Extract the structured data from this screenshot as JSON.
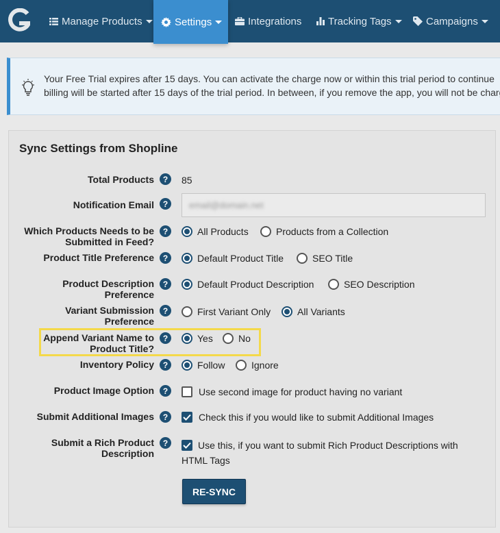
{
  "nav": {
    "items": [
      {
        "label": "Manage Products",
        "icon": "list-icon",
        "caret": true
      },
      {
        "label": "Settings",
        "icon": "gear-icon",
        "caret": true,
        "active": true
      },
      {
        "label": "Integrations",
        "icon": "briefcase-icon",
        "caret": false
      },
      {
        "label": "Tracking Tags",
        "icon": "bar-chart-icon",
        "caret": true
      },
      {
        "label": "Campaigns",
        "icon": "tag-icon",
        "caret": true
      }
    ]
  },
  "alert": {
    "line1": "Your Free Trial expires after 15 days. You can activate the charge now or within this trial period to continue",
    "line2": "billing will be started after 15 days of the trial period. In between, if you remove the app, you will not be charged."
  },
  "panel": {
    "title": "Sync Settings from Shopline",
    "rows": {
      "total_products": {
        "label": "Total Products",
        "value": "85"
      },
      "notification_email": {
        "label": "Notification Email",
        "value": "email@domain.net"
      },
      "which_products": {
        "label_line1": "Which Products Needs to be",
        "label_line2": "Submitted in Feed?",
        "options": [
          "All Products",
          "Products from a Collection"
        ],
        "selected": 0
      },
      "title_pref": {
        "label": "Product Title Preference",
        "options": [
          "Default Product Title",
          "SEO Title"
        ],
        "selected": 0
      },
      "desc_pref": {
        "label_line1": "Product Description",
        "label_line2": "Preference",
        "options": [
          "Default Product Description",
          "SEO Description"
        ],
        "selected": 0
      },
      "variant_pref": {
        "label_line1": "Variant Submission",
        "label_line2": "Preference",
        "options": [
          "First Variant Only",
          "All Variants"
        ],
        "selected": 1
      },
      "append_variant": {
        "label_line1": "Append Variant Name to",
        "label_line2": "Product Title?",
        "options": [
          "Yes",
          "No"
        ],
        "selected": 0
      },
      "inventory_policy": {
        "label": "Inventory Policy",
        "options": [
          "Follow",
          "Ignore"
        ],
        "selected": 0
      },
      "image_option": {
        "label": "Product Image Option",
        "checkbox_label": "Use second image for product having no variant",
        "checked": false
      },
      "additional_images": {
        "label": "Submit Additional Images",
        "checkbox_label": "Check this if you would like to submit Additional Images",
        "checked": true
      },
      "rich_desc": {
        "label_line1": "Submit a Rich Product",
        "label_line2": "Description",
        "checkbox_label": "Use this, if you want to submit Rich Product Descriptions with HTML Tags",
        "checked": true
      }
    },
    "help_glyph": "?",
    "resync_label": "RE-SYNC"
  },
  "colors": {
    "navbar": "#1d4f73",
    "nav_active": "#3b8ecf",
    "highlight": "#f4d94a"
  }
}
